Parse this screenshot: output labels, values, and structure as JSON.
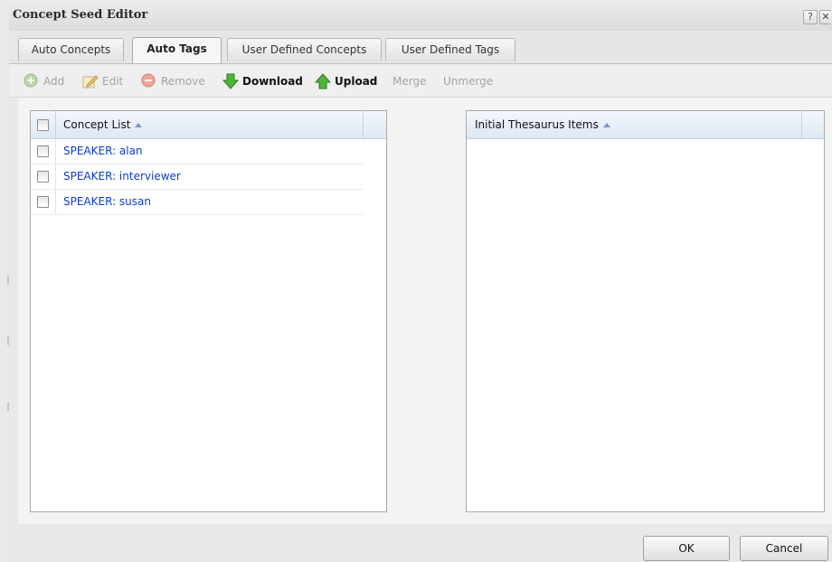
{
  "dialog": {
    "title": "Concept Seed Editor",
    "help_label": "?",
    "close_label": "✕"
  },
  "tabs": [
    {
      "label": "Auto Concepts",
      "active": false
    },
    {
      "label": "Auto Tags",
      "active": true
    },
    {
      "label": "User Defined Concepts",
      "active": false
    },
    {
      "label": "User Defined Tags",
      "active": false
    }
  ],
  "toolbar": {
    "add": {
      "label": "Add",
      "icon": "add-circle-icon",
      "enabled": false
    },
    "edit": {
      "label": "Edit",
      "icon": "edit-pencil-icon",
      "enabled": false
    },
    "remove": {
      "label": "Remove",
      "icon": "remove-circle-icon",
      "enabled": false
    },
    "download": {
      "label": "Download",
      "icon": "download-arrow-icon",
      "enabled": true
    },
    "upload": {
      "label": "Upload",
      "icon": "upload-arrow-icon",
      "enabled": true
    },
    "merge": {
      "label": "Merge",
      "enabled": false
    },
    "unmerge": {
      "label": "Unmerge",
      "enabled": false
    }
  },
  "concept_list": {
    "header": "Concept List",
    "sorted": "ascending",
    "items": [
      {
        "label": "SPEAKER: alan",
        "checked": false
      },
      {
        "label": "SPEAKER: interviewer",
        "checked": false
      },
      {
        "label": "SPEAKER: susan",
        "checked": false
      }
    ]
  },
  "thesaurus": {
    "header": "Initial Thesaurus Items",
    "sorted": "ascending",
    "items": []
  },
  "footer": {
    "ok_label": "OK",
    "cancel_label": "Cancel"
  },
  "colors": {
    "link_text": "#0b3ccf",
    "header_gradient_top": "#f4f7fc",
    "header_gradient_bottom": "#dde7f4",
    "download_green": "#3aa02c",
    "upload_green": "#3aa02c"
  }
}
